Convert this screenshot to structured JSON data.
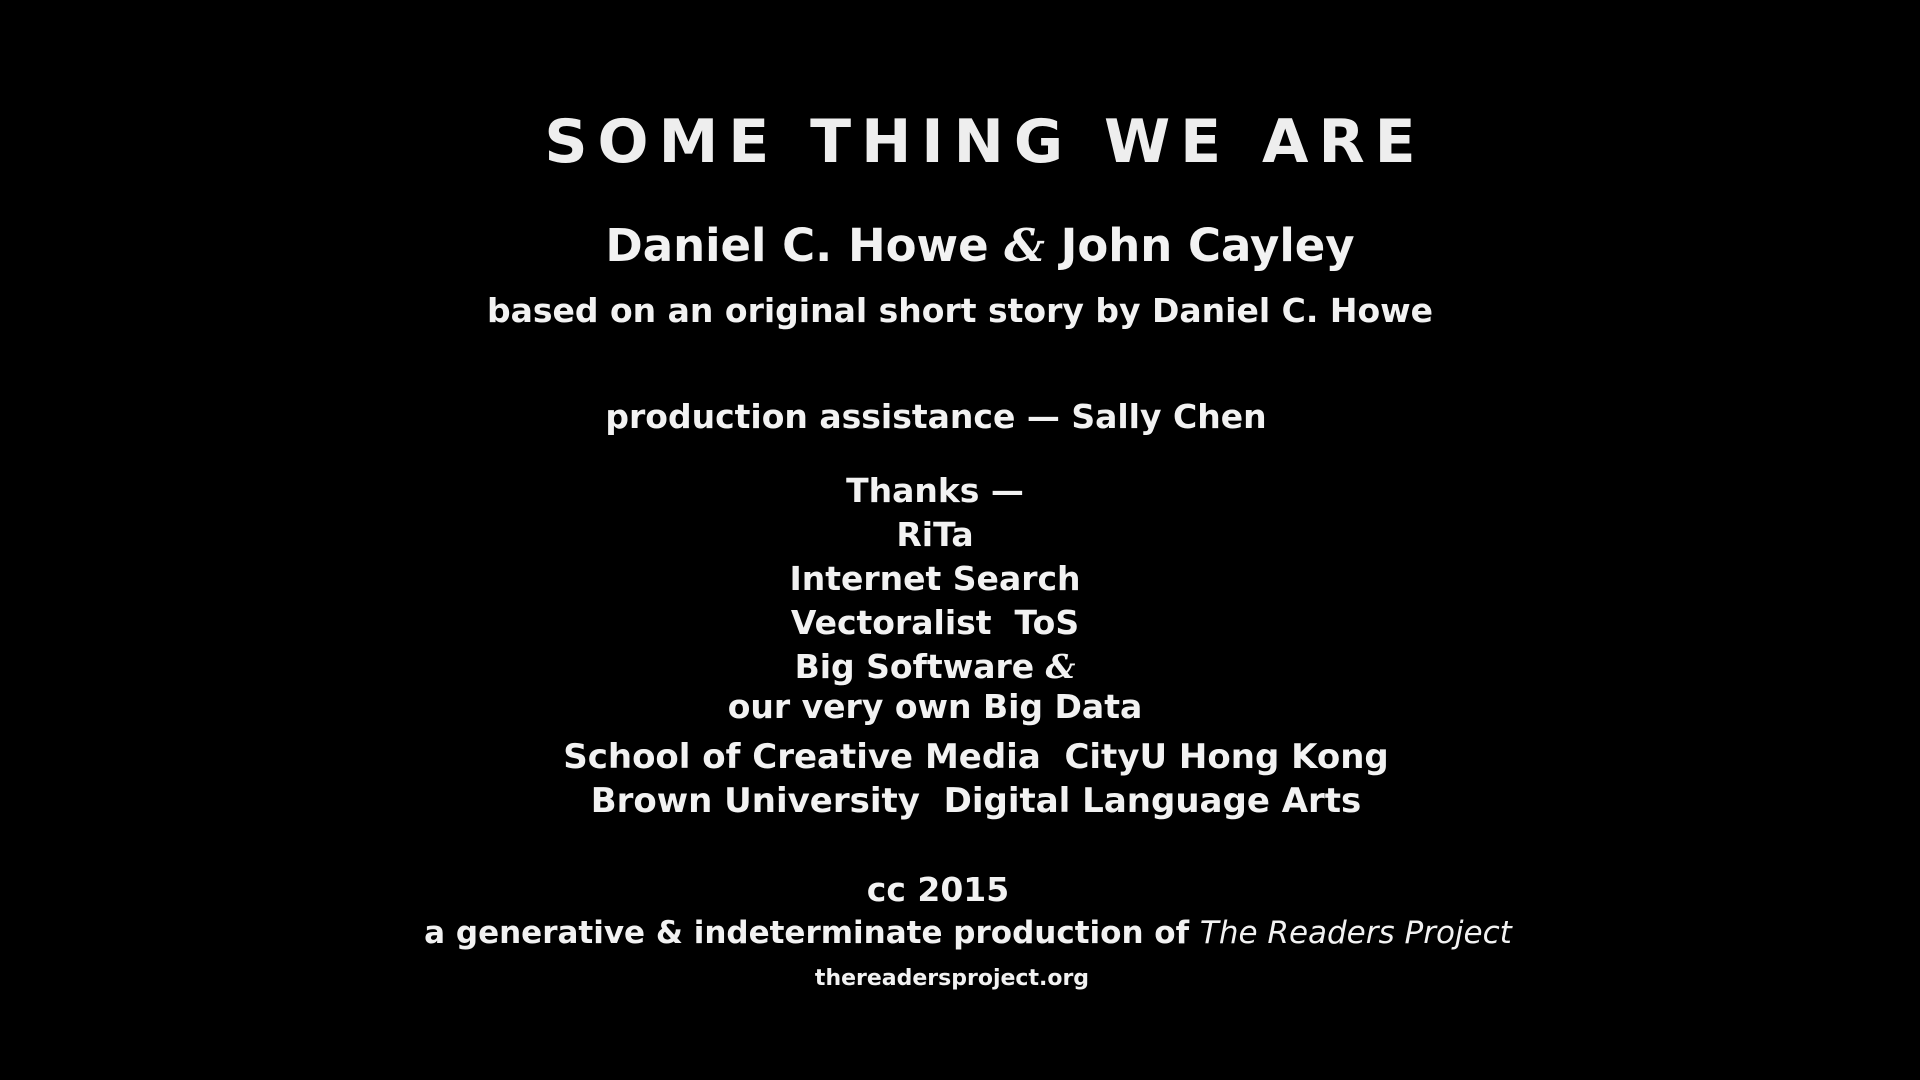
{
  "title": "SOME THING WE ARE",
  "authors": {
    "first": "Daniel C. Howe",
    "ampersand": "&",
    "second": "John Cayley"
  },
  "based_on": "based on an original short story by Daniel C. Howe",
  "production_assistance": "production assistance — Sally Chen",
  "thanks": {
    "heading": "Thanks —",
    "items": {
      "rita": "RiTa",
      "internet_search": "Internet Search",
      "vectoralist": "Vectoralist  ToS",
      "big_software": "Big Software",
      "ampersand": "&",
      "big_data": "our very own Big Data"
    }
  },
  "institutions": {
    "school": "School of Creative Media  CityU Hong Kong",
    "brown": "Brown University  Digital Language Arts"
  },
  "license": "cc 2015",
  "production_note": {
    "prefix": "a generative & indeterminate production of ",
    "project": "The Readers Project"
  },
  "url": "thereadersproject.org"
}
